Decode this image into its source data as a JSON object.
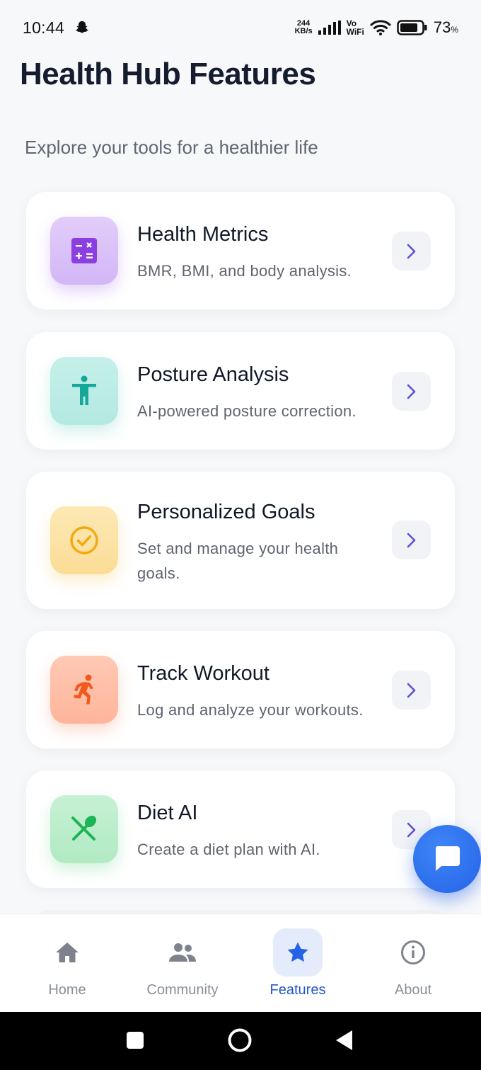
{
  "status_bar": {
    "time": "10:44",
    "net_speed_value": "244",
    "net_speed_unit": "KB/s",
    "vo": "Vo",
    "wifi_label": "WiFi",
    "battery_percent": "73",
    "battery_unit": "%"
  },
  "header": {
    "title": "Health Hub Features",
    "subtitle": "Explore your tools for a healthier life"
  },
  "features": [
    {
      "title": "Health Metrics",
      "description": "BMR, BMI, and body analysis.",
      "icon": "calculator-icon",
      "color": "#8b3fe0"
    },
    {
      "title": "Posture Analysis",
      "description": "AI-powered posture correction.",
      "icon": "accessibility-icon",
      "color": "#14a89a"
    },
    {
      "title": "Personalized Goals",
      "description": "Set and manage your health goals.",
      "icon": "check-circle-icon",
      "color": "#f2a90d"
    },
    {
      "title": "Track Workout",
      "description": "Log and analyze your workouts.",
      "icon": "running-icon",
      "color": "#f05a1f"
    },
    {
      "title": "Diet AI",
      "description": "Create a diet plan with AI.",
      "icon": "utensils-icon",
      "color": "#1cb455"
    }
  ],
  "bottom_nav": [
    {
      "label": "Home",
      "icon": "home-icon",
      "active": false
    },
    {
      "label": "Community",
      "icon": "people-icon",
      "active": false
    },
    {
      "label": "Features",
      "icon": "star-icon",
      "active": true
    },
    {
      "label": "About",
      "icon": "info-icon",
      "active": false
    }
  ],
  "colors": {
    "accent": "#2563eb",
    "active_nav_bg": "#e4ecfb",
    "chevron": "#5b52d6"
  }
}
